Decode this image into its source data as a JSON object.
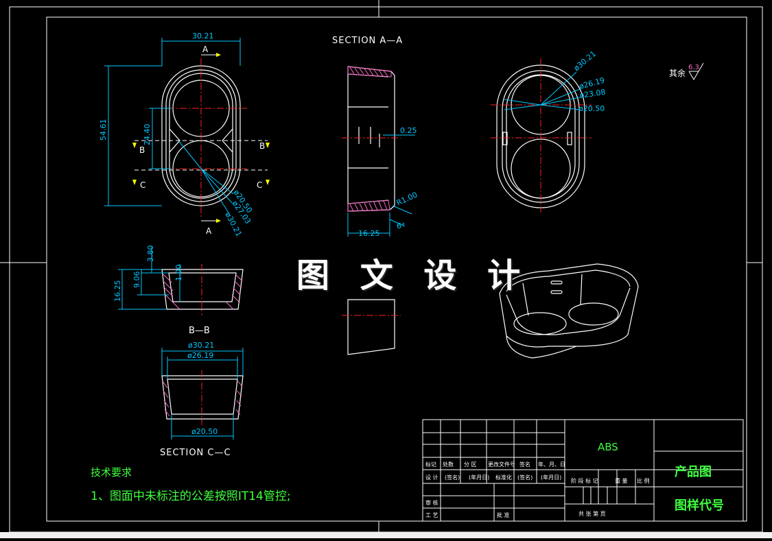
{
  "colors": {
    "background": "#000000",
    "outline": "#ffffff",
    "dimension": "#00c8ff",
    "centerline": "#ff2020",
    "hatch": "#ff69c8",
    "notes": "#40ff40",
    "cutting_arrow": "#ffff00",
    "border_bottom": "#f0f0f0"
  },
  "watermark": "图 文 设 计",
  "views": {
    "section_aa": {
      "title": "SECTION A—A",
      "dim_wall": "0.25",
      "dim_radius": "R1.00",
      "dim_angle": "6°",
      "dim_height": "16.25"
    },
    "section_bb": {
      "title": "B—B",
      "dim_height": "16.25",
      "dim_a": "3.80",
      "dim_b": "9.06",
      "dim_c": "1.00"
    },
    "section_cc": {
      "title": "SECTION C—C",
      "dim_top": "ø30.21",
      "dim_mid": "ø26.19",
      "dim_bottom": "ø20.50"
    },
    "top_view": {
      "dim_width": "30.21",
      "dim_length": "54.61",
      "dim_pitch": "24.40",
      "cut_a": "A",
      "cut_a2": "A",
      "cut_b": "B",
      "cut_b2": "B",
      "cut_c": "C",
      "cut_c2": "C",
      "dia1": "ø20.50",
      "dia2": "ø27.03",
      "dia3": "ø30.21"
    },
    "bottom_view": {
      "dia1": "ø30.21",
      "dia2": "ø26.19",
      "dia3": "ø23.08",
      "dia4": "ø20.50"
    }
  },
  "roughness": {
    "label": "其余",
    "value": "6.3"
  },
  "notes": {
    "heading": "技术要求",
    "line1": "1、图面中未标注的公差按照IT14管控;"
  },
  "title_block": {
    "material": "ABS",
    "product_name": "产品图",
    "drawing_code": "图样代号",
    "rev_headers": [
      "标记",
      "处数",
      "分 区",
      "更改文件号",
      "签名",
      "年、月、日"
    ],
    "sign_row": [
      "设 计",
      "(签名)",
      "(年月日)",
      "标准化",
      "(签名)",
      "(年月日)"
    ],
    "review": "审 核",
    "process": "工 艺",
    "approve": "批 准",
    "stage_headers": [
      "阶 段 标 记",
      "重 量",
      "比 例"
    ],
    "sheet_info": "共  张  第  页"
  }
}
